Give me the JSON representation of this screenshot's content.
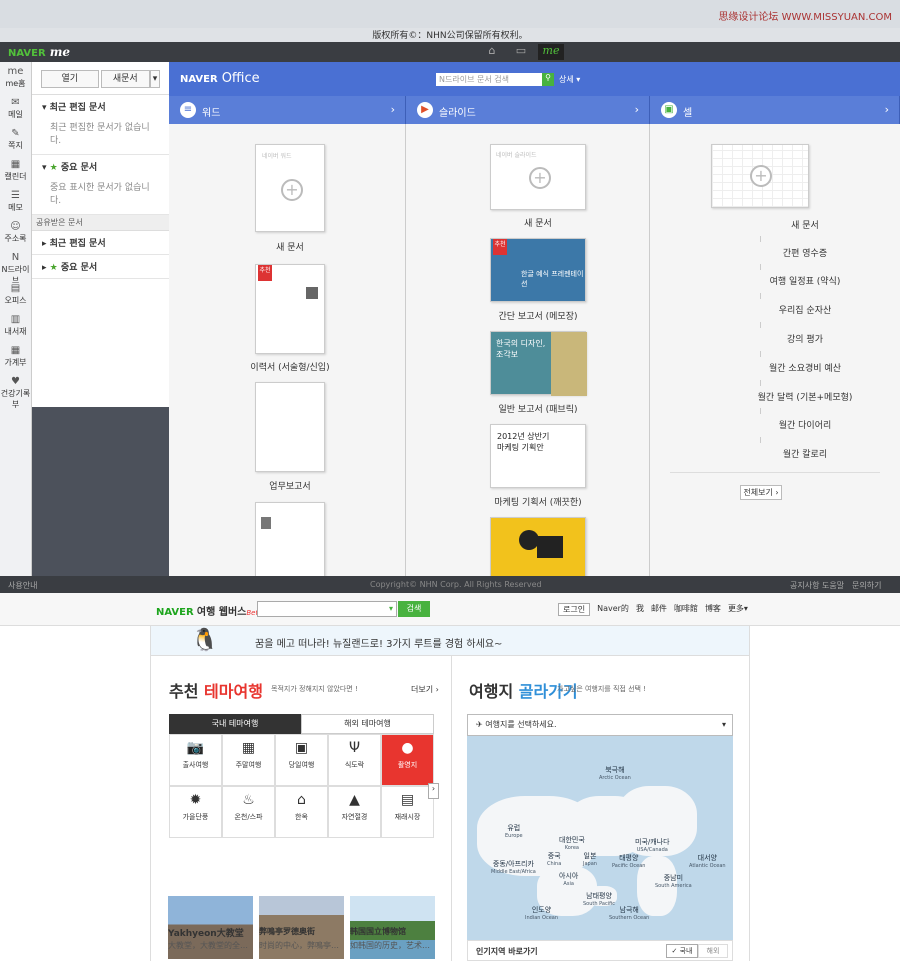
{
  "watermark": "思缘设计论坛 WWW.MISSYUAN.COM",
  "copyright_top": "版权所有©：NHN公司保留所有权利。",
  "me_bar": {
    "brand": "NAVER",
    "brand_me": "me",
    "home_icon": "home-icon",
    "window_icon": "window-icon",
    "me_tab": "me"
  },
  "left_rail": [
    {
      "label": "me홈",
      "icon": "me-icon"
    },
    {
      "label": "메일",
      "icon": "mail-icon"
    },
    {
      "label": "쪽지",
      "icon": "note-icon"
    },
    {
      "label": "캘린더",
      "icon": "calendar-icon"
    },
    {
      "label": "메모",
      "icon": "memo-icon"
    },
    {
      "label": "주소록",
      "icon": "contacts-icon"
    },
    {
      "label": "N드라이브",
      "icon": "ndrive-icon"
    },
    {
      "label": "오피스",
      "icon": "office-icon"
    },
    {
      "label": "내서재",
      "icon": "library-icon"
    },
    {
      "label": "가계부",
      "icon": "account-book-icon"
    },
    {
      "label": "건강기록부",
      "icon": "health-icon"
    }
  ],
  "panel": {
    "open_btn": "열기",
    "new_btn": "새문서",
    "recent": "최근 편집 문서",
    "recent_empty": "최근 편집한 문서가 없습니다.",
    "important": "중요 문서",
    "important_empty": "중요 표시한 문서가 없습니다.",
    "shared": "공유받은 문서",
    "shared_recent": "최근 편집 문서",
    "shared_important": "중요 문서"
  },
  "office": {
    "brand": "NAVER",
    "title": "Office",
    "search_placeholder": "N드라이브 문서 검색",
    "detail": "상세"
  },
  "columns": {
    "word": {
      "label": "워드",
      "docs": [
        "새 문서",
        "이력서 (서술형/신입)",
        "업무보고서"
      ]
    },
    "slide": {
      "label": "슬라이드",
      "docs": [
        "새 문서",
        "간단 보고서 (메모장)",
        "일반 보고서 (패브릭)",
        "마케팅 기획서 (깨끗한)"
      ]
    },
    "cell": {
      "label": "셀",
      "docs": [
        "새 문서",
        "간편 영수증",
        "여행 일정표 (약식)",
        "우리집 순자산",
        "강의 평가",
        "월간 소요경비 예산",
        "월간 달력 (기본+메모형)",
        "월간 다이어리",
        "월간 칼로리"
      ],
      "more": "전체보기 ›"
    }
  },
  "thumb_text": {
    "new_word": "네이버 워드",
    "new_slide": "네이버 슬라이드",
    "recommend": "추천",
    "slide1": "한글 예식 프레젠테이션",
    "slide2": "한국의 디자인, 조각보",
    "slide3": "2012년 상반기 마케팅 기획안"
  },
  "footer": {
    "left": "사용안내",
    "center": "Copyright© NHN Corp. All Rights Reserved",
    "links": [
      "공지사항",
      "도움말",
      "문의하기"
    ]
  },
  "travel": {
    "brand": "NAVER",
    "title": "여행 웹버스",
    "beta": "Beta",
    "search_btn": "검색",
    "header_links": [
      "로그인",
      "Naver的",
      "我",
      "邮件",
      "咖啡館",
      "博客",
      "更多▾"
    ],
    "banner": "꿈을 메고 떠나라! 뉴질랜드로! 3가지 루트를 경험 하세요~",
    "theme_title_a": "추천",
    "theme_title_b": "테마여행",
    "theme_sub": "목적지가 정해지지 않았다면 !",
    "theme_more": "더보기 ›",
    "tab_domestic": "국내 테마여행",
    "tab_overseas": "해외 테마여행",
    "categories": [
      {
        "label": "출사여행",
        "icon": "camera-icon",
        "glyph": "📷"
      },
      {
        "label": "주말여행",
        "icon": "calendar-icon",
        "glyph": "▦"
      },
      {
        "label": "당일여행",
        "icon": "bag-icon",
        "glyph": "▣"
      },
      {
        "label": "식도락",
        "icon": "fork-icon",
        "glyph": "Ψ"
      },
      {
        "label": "촬영지",
        "icon": "film-icon",
        "glyph": "●"
      },
      {
        "label": "가을단풍",
        "icon": "leaf-icon",
        "glyph": "✹"
      },
      {
        "label": "온천/스파",
        "icon": "spa-icon",
        "glyph": "♨"
      },
      {
        "label": "한옥",
        "icon": "hanok-icon",
        "glyph": "⌂"
      },
      {
        "label": "자연절경",
        "icon": "mountain-icon",
        "glyph": "▲"
      },
      {
        "label": "재래시장",
        "icon": "market-icon",
        "glyph": "▤"
      }
    ],
    "photos": [
      {
        "title": "Yakhyeon大教堂",
        "desc": "大教堂，大教堂的全…"
      },
      {
        "title": "弊鳴亭罗德奥街",
        "desc": "时尚的中心，弊鳴亭…"
      },
      {
        "title": "韩国国立博物馆",
        "desc": "如韩国的历史，艺术…"
      }
    ],
    "dest_title_a": "여행지",
    "dest_title_b": "골라가기",
    "dest_sub": "가고싶은 여행지를 직접 선택 !",
    "dest_select": "여행지를 선택하세요.",
    "map_labels": [
      {
        "ko": "북극해",
        "en": "Arctic Ocean"
      },
      {
        "ko": "유럽",
        "en": "Europe"
      },
      {
        "ko": "대한민국",
        "en": "Korea"
      },
      {
        "ko": "중국",
        "en": "China"
      },
      {
        "ko": "일본",
        "en": "Japan"
      },
      {
        "ko": "미국/캐나다",
        "en": "USA/Canada"
      },
      {
        "ko": "태평양",
        "en": "Pacific Ocean"
      },
      {
        "ko": "대서양",
        "en": "Atlantic Ocean"
      },
      {
        "ko": "중동/아프리카",
        "en": "Middle East/Africa"
      },
      {
        "ko": "아시아",
        "en": "Asia"
      },
      {
        "ko": "남태평양",
        "en": "South Pacific"
      },
      {
        "ko": "중남미",
        "en": "South America"
      },
      {
        "ko": "인도양",
        "en": "Indian Ocean"
      },
      {
        "ko": "남극해",
        "en": "Southern Ocean"
      }
    ],
    "popular": "인기지역 바로가기",
    "dom": "✓ 국내",
    "ovs": "해외"
  }
}
